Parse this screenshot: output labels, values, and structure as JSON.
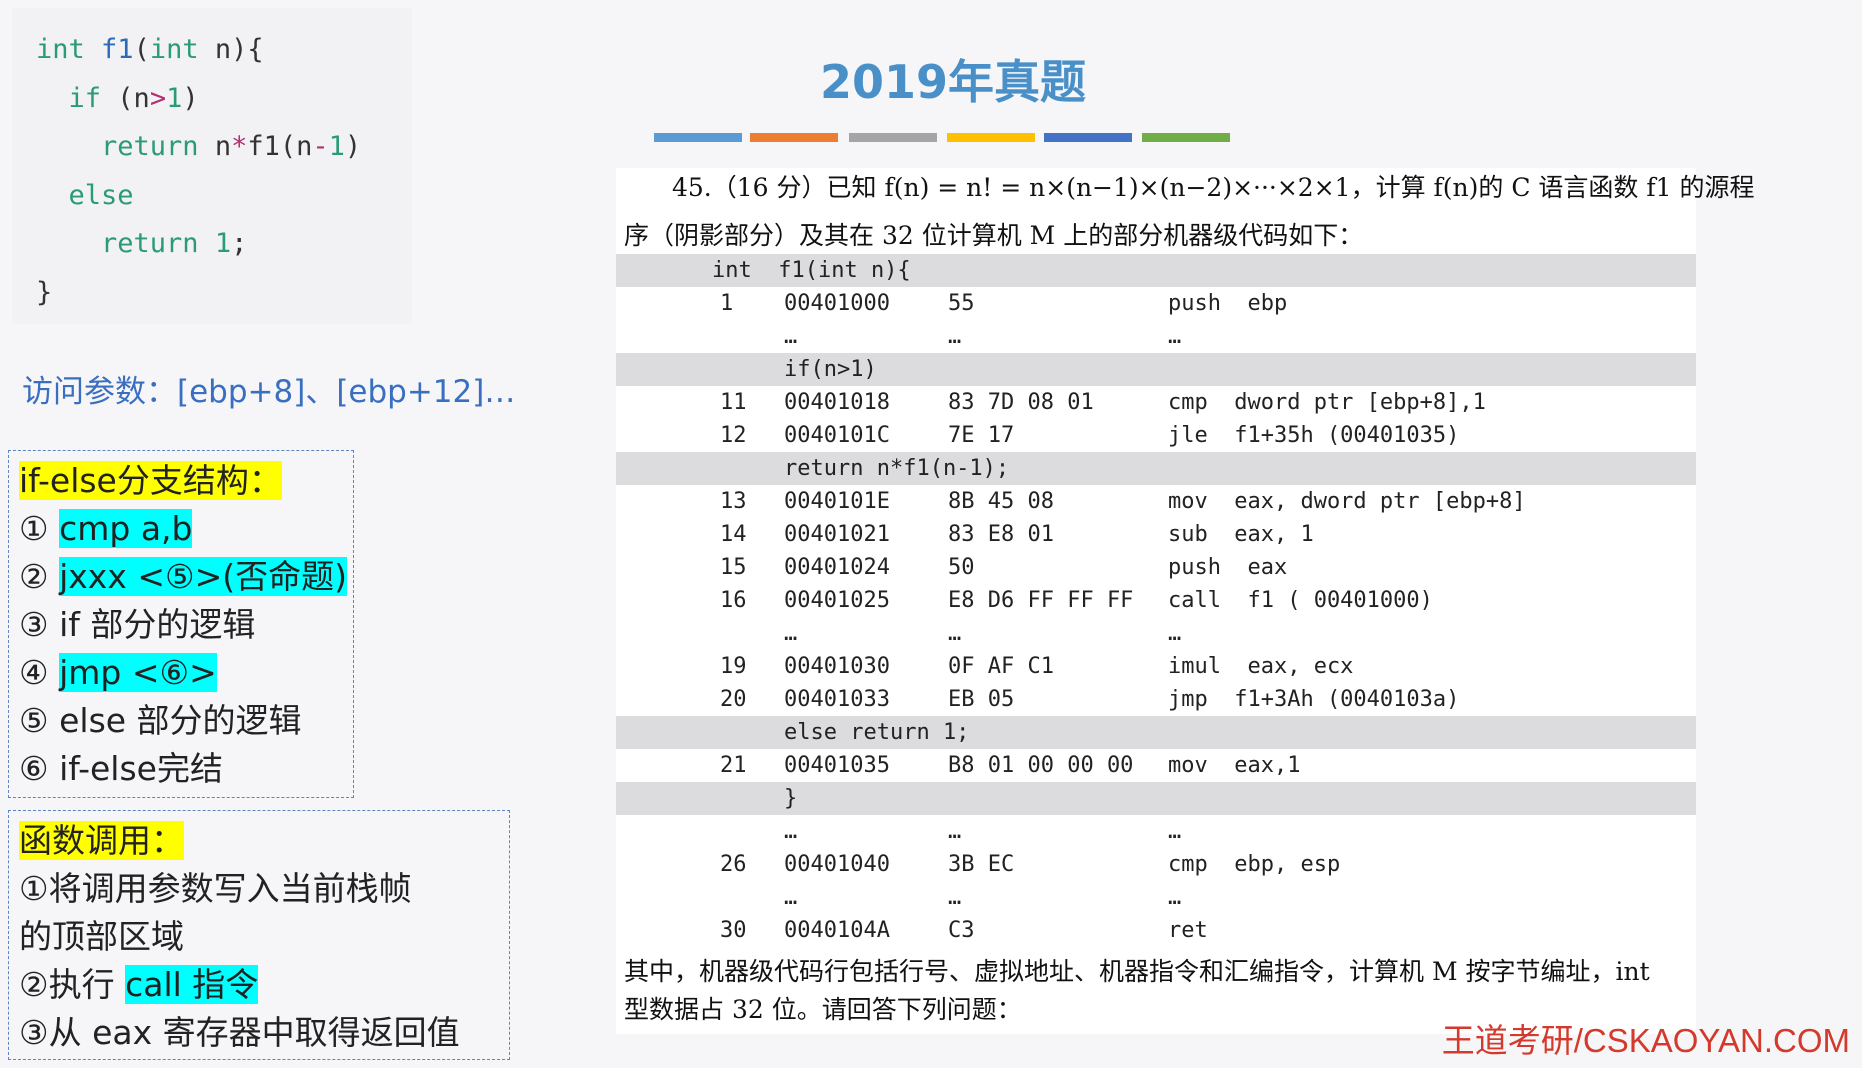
{
  "code": {
    "lines": [
      "int f1(int n){",
      "  if (n>1)",
      "    return n*f1(n-1)",
      "  else",
      "    return 1;",
      "}"
    ]
  },
  "param_note": "访问参数：[ebp+8]、[ebp+12]…",
  "ifelse_box": {
    "heading": "if-else分支结构：",
    "items": [
      {
        "num": "①",
        "text": "cmp a,b"
      },
      {
        "num": "②",
        "text": "jxxx <⑤>(否命题)"
      },
      {
        "num": "③",
        "text": "if 部分的逻辑"
      },
      {
        "num": "④",
        "text": "jmp <⑥>"
      },
      {
        "num": "⑤",
        "text": "else 部分的逻辑"
      },
      {
        "num": "⑥",
        "text": "if-else完结"
      }
    ]
  },
  "call_box": {
    "heading": "函数调用：",
    "line1": "①将调用参数写入当前栈帧",
    "line2": "的顶部区域",
    "line3_prefix": "②执行 ",
    "line3_hl": "call 指令",
    "line4": "③从 eax 寄存器中取得返回值"
  },
  "title": "2019年真题",
  "bar_colors": [
    "#5b9bd5",
    "#ed7d31",
    "#a5a5a5",
    "#ffc000",
    "#4472c4",
    "#70ad47"
  ],
  "question": {
    "line1": "45.（16 分）已知 f(n) = n! = n×(n−1)×(n−2)×···×2×1，计算 f(n)的 C 语言函数 f1 的源程",
    "line2": "序（阴影部分）及其在 32 位计算机 M 上的部分机器级代码如下：",
    "tail1": "其中，机器级代码行包括行号、虚拟地址、机器指令和汇编指令，计算机  M  按字节编址，int",
    "tail2": "型数据占 32 位。请回答下列问题："
  },
  "asm_rows": [
    {
      "shaded": true,
      "src0": "int  f1(int n){"
    },
    {
      "line": "1",
      "addr": "00401000",
      "mc": "55",
      "ins": "push  ebp"
    },
    {
      "addr": "…",
      "mc": "…",
      "ins": "…"
    },
    {
      "shaded": true,
      "src": "if(n>1)"
    },
    {
      "line": "11",
      "addr": "00401018",
      "mc": "83 7D 08 01",
      "ins": "cmp  dword ptr [ebp+8],1"
    },
    {
      "line": "12",
      "addr": "0040101C",
      "mc": "7E 17",
      "ins": "jle  f1+35h (00401035)"
    },
    {
      "shaded": true,
      "src": "return n*f1(n-1);"
    },
    {
      "line": "13",
      "addr": "0040101E",
      "mc": "8B 45 08",
      "ins": "mov  eax, dword ptr [ebp+8]"
    },
    {
      "line": "14",
      "addr": "00401021",
      "mc": "83 E8 01",
      "ins": "sub  eax, 1"
    },
    {
      "line": "15",
      "addr": "00401024",
      "mc": "50",
      "ins": "push  eax"
    },
    {
      "line": "16",
      "addr": "00401025",
      "mc": "E8 D6 FF FF FF",
      "ins": "call  f1 ( 00401000)"
    },
    {
      "addr": "…",
      "mc": "…",
      "ins": "…"
    },
    {
      "line": "19",
      "addr": "00401030",
      "mc": "0F AF C1",
      "ins": "imul  eax, ecx"
    },
    {
      "line": "20",
      "addr": "00401033",
      "mc": "EB 05",
      "ins": "jmp  f1+3Ah (0040103a)"
    },
    {
      "shaded": true,
      "src": "else return 1;"
    },
    {
      "line": "21",
      "addr": "00401035",
      "mc": "B8 01 00 00 00",
      "ins": "mov  eax,1"
    },
    {
      "shaded": true,
      "src": "}"
    },
    {
      "addr": "…",
      "mc": "…",
      "ins": "…"
    },
    {
      "line": "26",
      "addr": "00401040",
      "mc": "3B EC",
      "ins": "cmp  ebp, esp"
    },
    {
      "addr": "…",
      "mc": "…",
      "ins": "…"
    },
    {
      "line": "30",
      "addr": "0040104A",
      "mc": "C3",
      "ins": "ret"
    }
  ],
  "brand": "王道考研/CSKAOYAN.COM"
}
